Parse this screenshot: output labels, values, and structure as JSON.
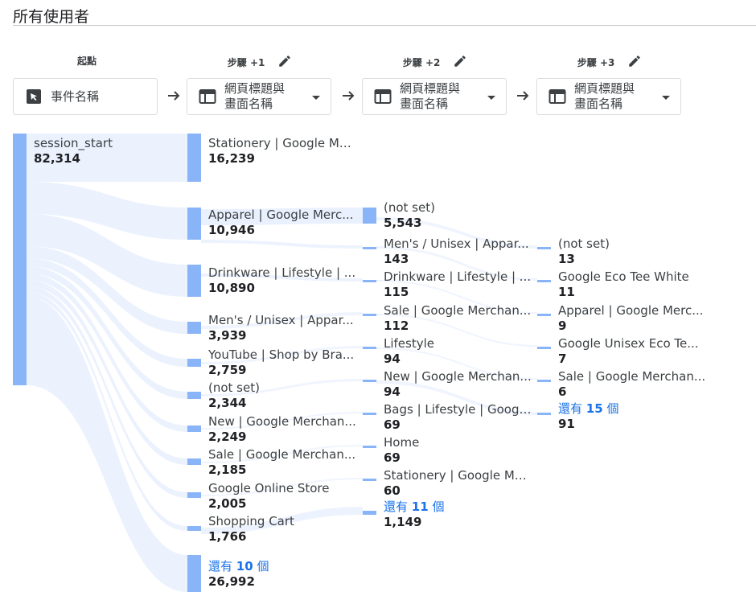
{
  "segment_title": "所有使用者",
  "steps": [
    {
      "label": "起點",
      "box_text": "事件名稱",
      "icon": "cursor-click-icon",
      "has_dropdown": false,
      "editable": false
    },
    {
      "label": "步驟 +1",
      "box_text": "網頁標題與\n畫面名稱",
      "icon": "web-page-icon",
      "has_dropdown": true,
      "editable": true
    },
    {
      "label": "步驟 +2",
      "box_text": "網頁標題與\n畫面名稱",
      "icon": "web-page-icon",
      "has_dropdown": true,
      "editable": true
    },
    {
      "label": "步驟 +3",
      "box_text": "網頁標題與\n畫面名稱",
      "icon": "web-page-icon",
      "has_dropdown": true,
      "editable": true
    }
  ],
  "column0": [
    {
      "name": "session_start",
      "value": "82,314"
    }
  ],
  "column1": [
    {
      "name": "Stationery | Google Me...",
      "value": "16,239"
    },
    {
      "name": "Apparel | Google Merc...",
      "value": "10,946"
    },
    {
      "name": "Drinkware | Lifestyle | ...",
      "value": "10,890"
    },
    {
      "name": "Men's / Unisex | Appar...",
      "value": "3,939"
    },
    {
      "name": "YouTube | Shop by Bra...",
      "value": "2,759"
    },
    {
      "name": "(not set)",
      "value": "2,344"
    },
    {
      "name": "New | Google Merchan...",
      "value": "2,249"
    },
    {
      "name": "Sale | Google Merchan...",
      "value": "2,185"
    },
    {
      "name": "Google Online Store",
      "value": "2,005"
    },
    {
      "name": "Shopping Cart",
      "value": "1,766"
    }
  ],
  "column1_more": {
    "prefix": "還有",
    "count": "10",
    "suffix": "個",
    "value": "26,992"
  },
  "column2": [
    {
      "name": "(not set)",
      "value": "5,543"
    },
    {
      "name": "Men's / Unisex | Appar...",
      "value": "143"
    },
    {
      "name": "Drinkware | Lifestyle | ...",
      "value": "115"
    },
    {
      "name": "Sale | Google Merchan...",
      "value": "112"
    },
    {
      "name": "Lifestyle",
      "value": "94"
    },
    {
      "name": "New | Google Merchan...",
      "value": "94"
    },
    {
      "name": "Bags | Lifestyle | Googl...",
      "value": "69"
    },
    {
      "name": "Home",
      "value": "69"
    },
    {
      "name": "Stationery | Google Me...",
      "value": "60"
    }
  ],
  "column2_more": {
    "prefix": "還有",
    "count": "11",
    "suffix": "個",
    "value": "1,149"
  },
  "column3": [
    {
      "name": "(not set)",
      "value": "13"
    },
    {
      "name": "Google Eco Tee White",
      "value": "11"
    },
    {
      "name": "Apparel | Google Merc...",
      "value": "9"
    },
    {
      "name": "Google Unisex Eco Te...",
      "value": "7"
    },
    {
      "name": "Sale | Google Merchan...",
      "value": "6"
    }
  ],
  "column3_more": {
    "prefix": "還有",
    "count": "15",
    "suffix": "個",
    "value": "91"
  },
  "colors": {
    "bar": "#8ab4f8",
    "flow": "#e8f0fe",
    "link": "#1a73e8",
    "text": "#3c4043"
  }
}
